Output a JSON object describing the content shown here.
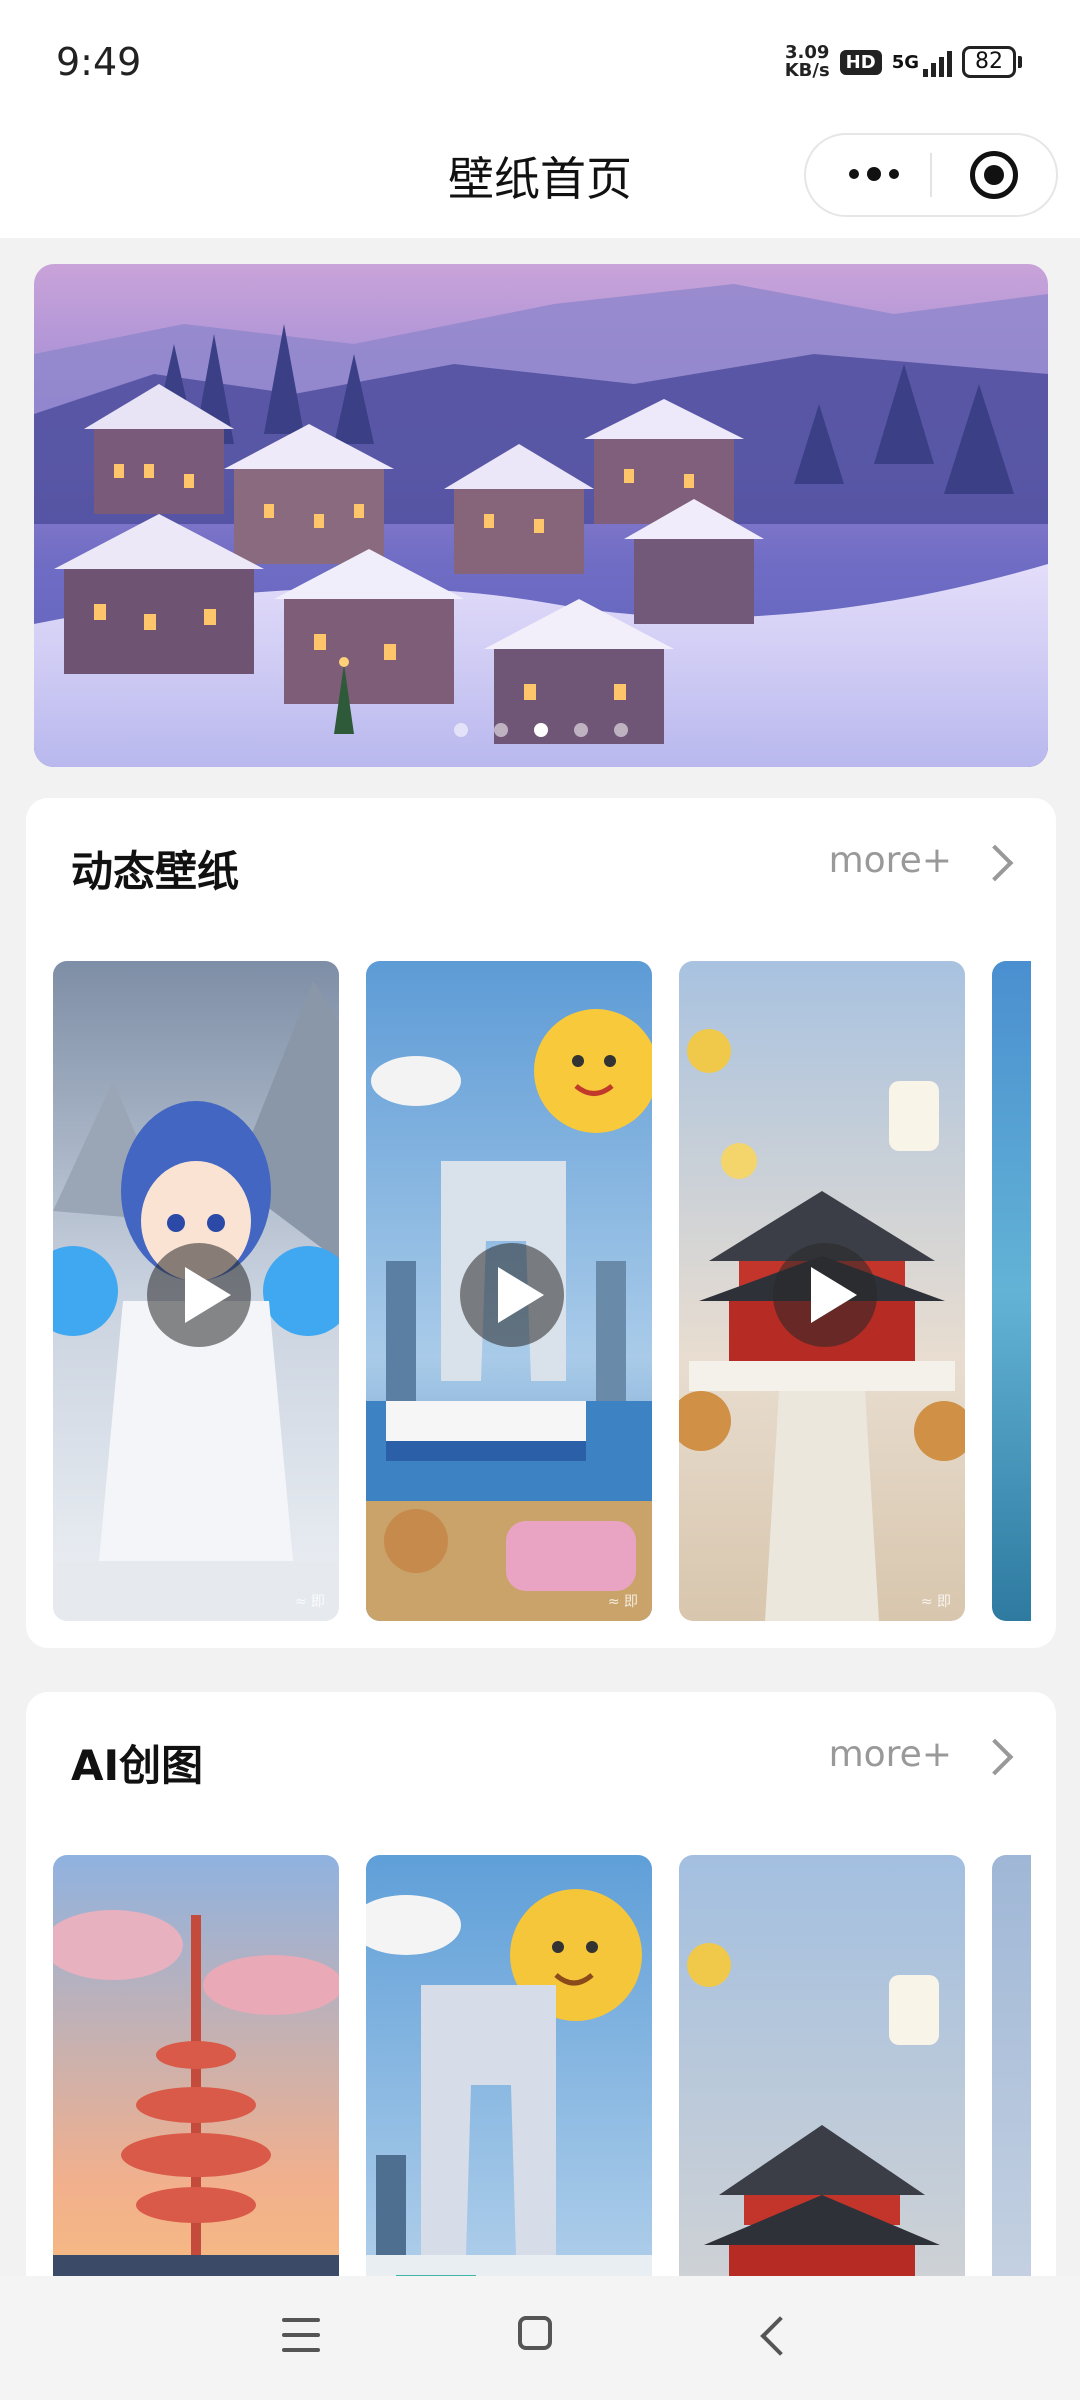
{
  "status_bar": {
    "time": "9:49",
    "net_speed_value": "3.09",
    "net_speed_unit": "KB/s",
    "hd_label": "HD",
    "network_label": "5G",
    "battery_level": "82"
  },
  "nav": {
    "title": "壁纸首页",
    "more_icon": "more-dots-icon",
    "target_icon": "record-target-icon"
  },
  "banner": {
    "slide_count": 5,
    "active_index": 2
  },
  "sections": [
    {
      "title": "动态壁纸",
      "more_label": "more+",
      "items": [
        {
          "name": "dragon-boy-wallpaper",
          "video": true,
          "watermark": "≈ 即"
        },
        {
          "name": "city-sun-wallpaper",
          "video": true,
          "watermark": "≈ 即"
        },
        {
          "name": "temple-heaven-wallpaper",
          "video": true,
          "watermark": "≈ 即"
        },
        {
          "name": "ocean-wallpaper",
          "video": true
        }
      ]
    },
    {
      "title": "AI创图",
      "more_label": "more+",
      "items": [
        {
          "name": "sunset-tower-image"
        },
        {
          "name": "city-sun-image"
        },
        {
          "name": "temple-heaven-image"
        },
        {
          "name": "partial-image"
        }
      ]
    }
  ],
  "system_nav": {
    "menu_icon": "menu-icon",
    "home_icon": "home-square-icon",
    "back_icon": "back-chevron-icon"
  }
}
